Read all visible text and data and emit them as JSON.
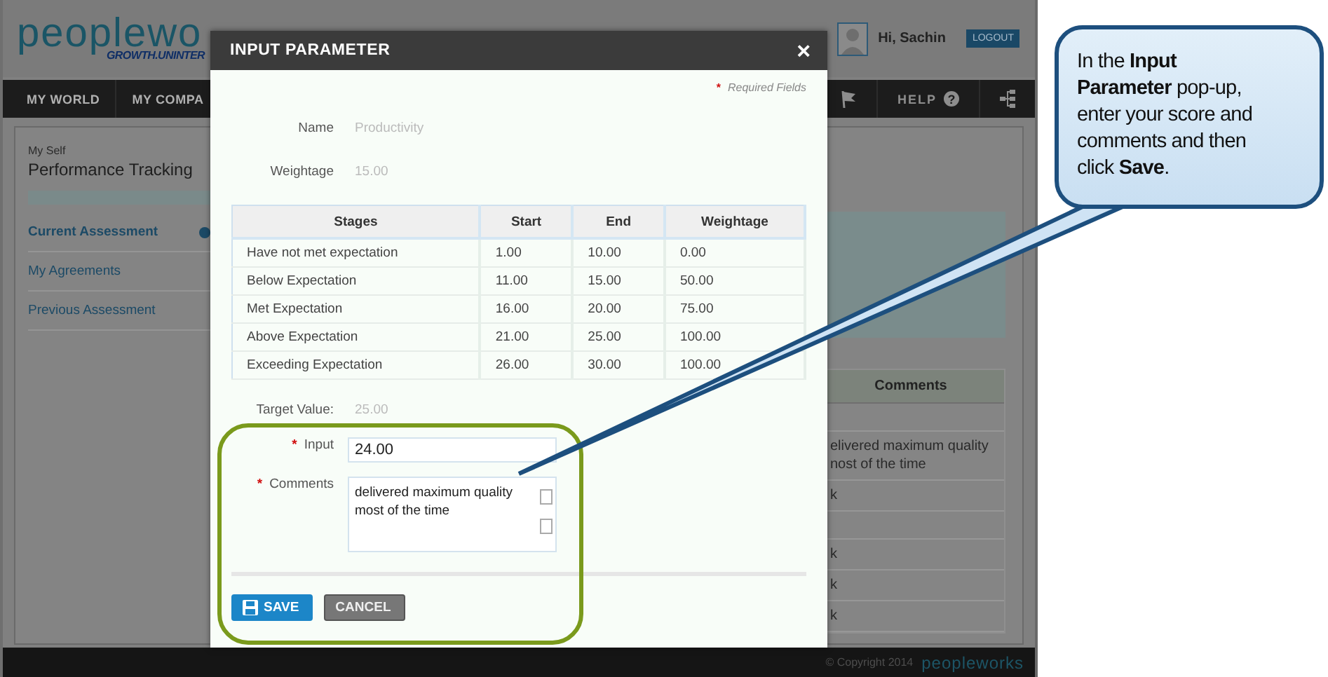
{
  "app": {
    "logo": "peoplewo",
    "tagline": "GROWTH.UNINTER",
    "greeting": "Hi, Sachin",
    "logout": "LOGOUT",
    "nav": [
      {
        "label": "MY WORLD"
      },
      {
        "label": "MY COMPA"
      }
    ],
    "nav_right": {
      "help": "HELP",
      "help_icon": "?"
    },
    "section": "My Self",
    "page_title": "Performance Tracking",
    "sidebar": [
      {
        "label": "Current Assessment",
        "selected": true
      },
      {
        "label": "My Agreements",
        "selected": false
      },
      {
        "label": "Previous Assessment",
        "selected": false
      }
    ],
    "table": {
      "columns": [
        "Comments"
      ],
      "rows": [
        {},
        {
          "comment": "elivered maximum quality nost of the time"
        },
        {
          "comment": "k"
        },
        {},
        {
          "comment": "k"
        },
        {
          "comment": "k"
        },
        {
          "comment": "k"
        }
      ]
    },
    "footer": {
      "copyright": "© Copyright 2014",
      "logo": "peopleworks"
    }
  },
  "dialog": {
    "title": "INPUT PARAMETER",
    "close": "×",
    "required_marker": "*",
    "required_note": "Required Fields",
    "info": [
      {
        "label": "Name",
        "value": "Productivity"
      },
      {
        "label": "Weightage",
        "value": "15.00"
      }
    ],
    "stages": {
      "columns": [
        "Stages",
        "Start",
        "End",
        "Weightage"
      ],
      "rows": [
        [
          "Have not met expectation",
          "1.00",
          "10.00",
          "0.00"
        ],
        [
          "Below Expectation",
          "11.00",
          "15.00",
          "50.00"
        ],
        [
          "Met Expectation",
          "16.00",
          "20.00",
          "75.00"
        ],
        [
          "Above Expectation",
          "21.00",
          "25.00",
          "100.00"
        ],
        [
          "Exceeding Expectation",
          "26.00",
          "30.00",
          "100.00"
        ]
      ]
    },
    "target": {
      "label": "Target Value:",
      "value": "25.00"
    },
    "fields": [
      {
        "kind": "input",
        "label": "Input",
        "required": true,
        "value": "24.00"
      },
      {
        "kind": "textarea",
        "label": "Comments",
        "required": true,
        "value": "delivered maximum quality most of the time"
      }
    ],
    "buttons": [
      {
        "kind": "primary",
        "label": "SAVE"
      },
      {
        "kind": "secondary",
        "label": "CANCEL"
      }
    ]
  },
  "callout": {
    "text": "In the **Input Parameter** pop-up, enter your score and comments and then click **Save**."
  }
}
